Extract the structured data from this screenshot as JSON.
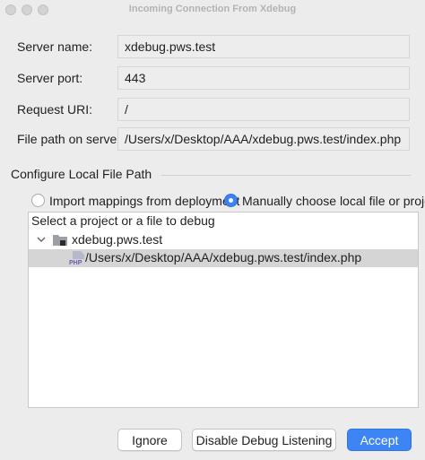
{
  "window": {
    "title": "Incoming Connection From Xdebug"
  },
  "server": {
    "name_label": "Server name:",
    "name_value": "xdebug.pws.test",
    "port_label": "Server port:",
    "port_value": "443",
    "uri_label": "Request URI:",
    "uri_value": "/",
    "path_label": "File path on server:",
    "path_value": "/Users/x/Desktop/AAA/xdebug.pws.test/index.php"
  },
  "local_path": {
    "section_title": "Configure Local File Path",
    "option_import": "Import mappings from deployment",
    "option_manual": "Manually choose local file or project",
    "selected_option": "manual"
  },
  "tree": {
    "header": "Select a project or a file to debug",
    "items": [
      {
        "label": "xdebug.pws.test",
        "icon": "folder-icon",
        "expanded": true
      },
      {
        "label": "/Users/x/Desktop/AAA/xdebug.pws.test/index.php",
        "icon": "php-file-icon",
        "selected": true
      }
    ]
  },
  "buttons": {
    "ignore": "Ignore",
    "disable": "Disable Debug Listening",
    "accept": "Accept"
  },
  "colors": {
    "accent": "#3d85f5",
    "selection": "#d5d5d5"
  }
}
